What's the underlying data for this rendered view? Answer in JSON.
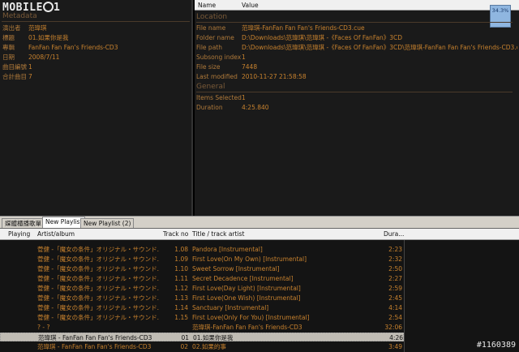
{
  "logo": {
    "text": "MOBILE01"
  },
  "metadata": {
    "section_title": "Metadata",
    "rows": [
      {
        "key": "演出者",
        "value": "范瑋琪"
      },
      {
        "key": "標題",
        "value": "01.如果你是我"
      },
      {
        "key": "專輯",
        "value": "FanFan Fan Fan's Friends-CD3"
      },
      {
        "key": "日期",
        "value": "2008/7/11"
      },
      {
        "key": "曲目編號",
        "value": "1"
      },
      {
        "key": "合計曲目",
        "value": "7"
      }
    ]
  },
  "properties": {
    "header": {
      "name": "Name",
      "value": "Value"
    },
    "badge": "34.3%",
    "location": {
      "title": "Location",
      "rows": [
        {
          "key": "File name",
          "value": "范瑋琪-FanFan Fan Fan's Friends-CD3.cue"
        },
        {
          "key": "Folder name",
          "value": "D:\\Downloads\\范瑋琪\\范瑋琪 -《Faces Of FanFan》3CD"
        },
        {
          "key": "File path",
          "value": "D:\\Downloads\\范瑋琪\\范瑋琪 -《Faces Of FanFan》3CD\\范瑋琪-FanFan Fan Fan's Friends-CD3.cue"
        },
        {
          "key": "Subsong index",
          "value": "1"
        },
        {
          "key": "File size",
          "value": "7448"
        },
        {
          "key": "Last modified",
          "value": "2010-11-27 21:58:58"
        }
      ]
    },
    "general": {
      "title": "General",
      "rows": [
        {
          "key": "Items Selected",
          "value": "1"
        },
        {
          "key": "Duration",
          "value": "4:25.840"
        }
      ]
    }
  },
  "tabs": [
    {
      "label": "媒體櫃播歌單"
    },
    {
      "label": "New Playlist",
      "active": true
    },
    {
      "label": "New Playlist (2)"
    }
  ],
  "playlist": {
    "columns": {
      "playing": "Playing",
      "artist": "Artist/album",
      "track": "Track no",
      "title": "Title / track artist",
      "duration": "Dura..."
    },
    "rows": [
      {
        "artist": "菅健 -「魔女の条件」オリジナル・サウンド...",
        "track": "1.08",
        "title": "Pandora [Instrumental]",
        "duration": "2:23"
      },
      {
        "artist": "菅健 -「魔女の条件」オリジナル・サウンド...",
        "track": "1.09",
        "title": "First Love(On My Own) [Instrumental]",
        "duration": "2:32"
      },
      {
        "artist": "菅健 -「魔女の条件」オリジナル・サウンド...",
        "track": "1.10",
        "title": "Sweet Sorrow [Instrumental]",
        "duration": "2:50"
      },
      {
        "artist": "菅健 -「魔女の条件」オリジナル・サウンド...",
        "track": "1.11",
        "title": "Secret Decadence [Instrumental]",
        "duration": "2:27"
      },
      {
        "artist": "菅健 -「魔女の条件」オリジナル・サウンド...",
        "track": "1.12",
        "title": "First Love(Day Light) [Instrumental]",
        "duration": "2:59"
      },
      {
        "artist": "菅健 -「魔女の条件」オリジナル・サウンド...",
        "track": "1.13",
        "title": "First Love(One Wish) [Instrumental]",
        "duration": "2:45"
      },
      {
        "artist": "菅健 -「魔女の条件」オリジナル・サウンド...",
        "track": "1.14",
        "title": "Sanctuary [Instrumental]",
        "duration": "4:14"
      },
      {
        "artist": "菅健 -「魔女の条件」オリジナル・サウンド...",
        "track": "1.15",
        "title": "First Love(Only For You) [Instrumental]",
        "duration": "2:54"
      }
    ],
    "group_row": {
      "artist": "? - ?",
      "title": "范瑋琪-FanFan Fan Fan's Friends-CD3",
      "duration": "32:06"
    },
    "selected_row": {
      "artist": "范瑋琪 - FanFan Fan Fan's Friends-CD3",
      "track": "01",
      "title": "01.如果你是我",
      "duration": "4:26"
    },
    "last_row": {
      "artist": "范瑋琪 - FanFan Fan Fan's Friends-CD3",
      "track": "02",
      "title": "02.如果的事",
      "duration": "3:49"
    }
  },
  "watermark": "#1160389"
}
